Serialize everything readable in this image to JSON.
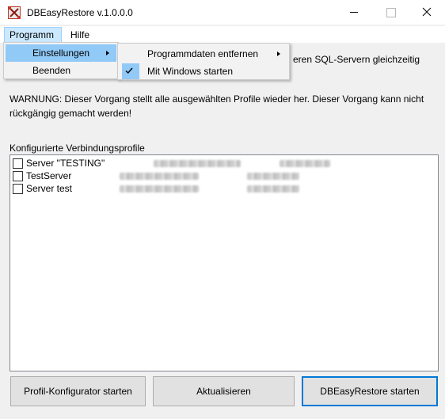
{
  "window": {
    "title": "DBEasyRestore v.1.0.0.0"
  },
  "menubar": {
    "items": [
      {
        "label": "Programm",
        "active": true
      },
      {
        "label": "Hilfe",
        "active": false
      }
    ]
  },
  "menu_programm": {
    "items": [
      {
        "label": "Einstellungen",
        "has_submenu": true,
        "highlighted": true
      },
      {
        "label": "Beenden",
        "has_submenu": false,
        "highlighted": false
      }
    ]
  },
  "menu_einstellungen": {
    "items": [
      {
        "label": "Programmdaten entfernen",
        "has_submenu": true,
        "checked": false
      },
      {
        "label": "Mit Windows starten",
        "has_submenu": false,
        "checked": true
      }
    ]
  },
  "main": {
    "partially_hidden_text": "eren SQL-Servern gleichzeitig",
    "warning": "WARNUNG: Dieser Vorgang stellt alle ausgewählten Profile wieder her. Dieser Vorgang kann nicht rückgängig gemacht werden!",
    "profiles_label": "Konfigurierte Verbindungsprofile",
    "profiles": [
      {
        "name": "Server \"TESTING\"",
        "checked": false
      },
      {
        "name": "TestServer",
        "checked": false
      },
      {
        "name": "Server test",
        "checked": false
      }
    ]
  },
  "buttons": {
    "config": "Profil-Konfigurator starten",
    "refresh": "Aktualisieren",
    "start": "DBEasyRestore starten"
  },
  "colors": {
    "accent": "#0078d7",
    "menu_highlight": "#91c9f7",
    "menubar_active": "#cce8ff"
  },
  "icons": {
    "app": "database-restore-icon",
    "minimize": "minimize-icon",
    "maximize": "maximize-icon",
    "close": "close-icon",
    "submenu": "chevron-right-icon",
    "check": "checkmark-icon"
  }
}
